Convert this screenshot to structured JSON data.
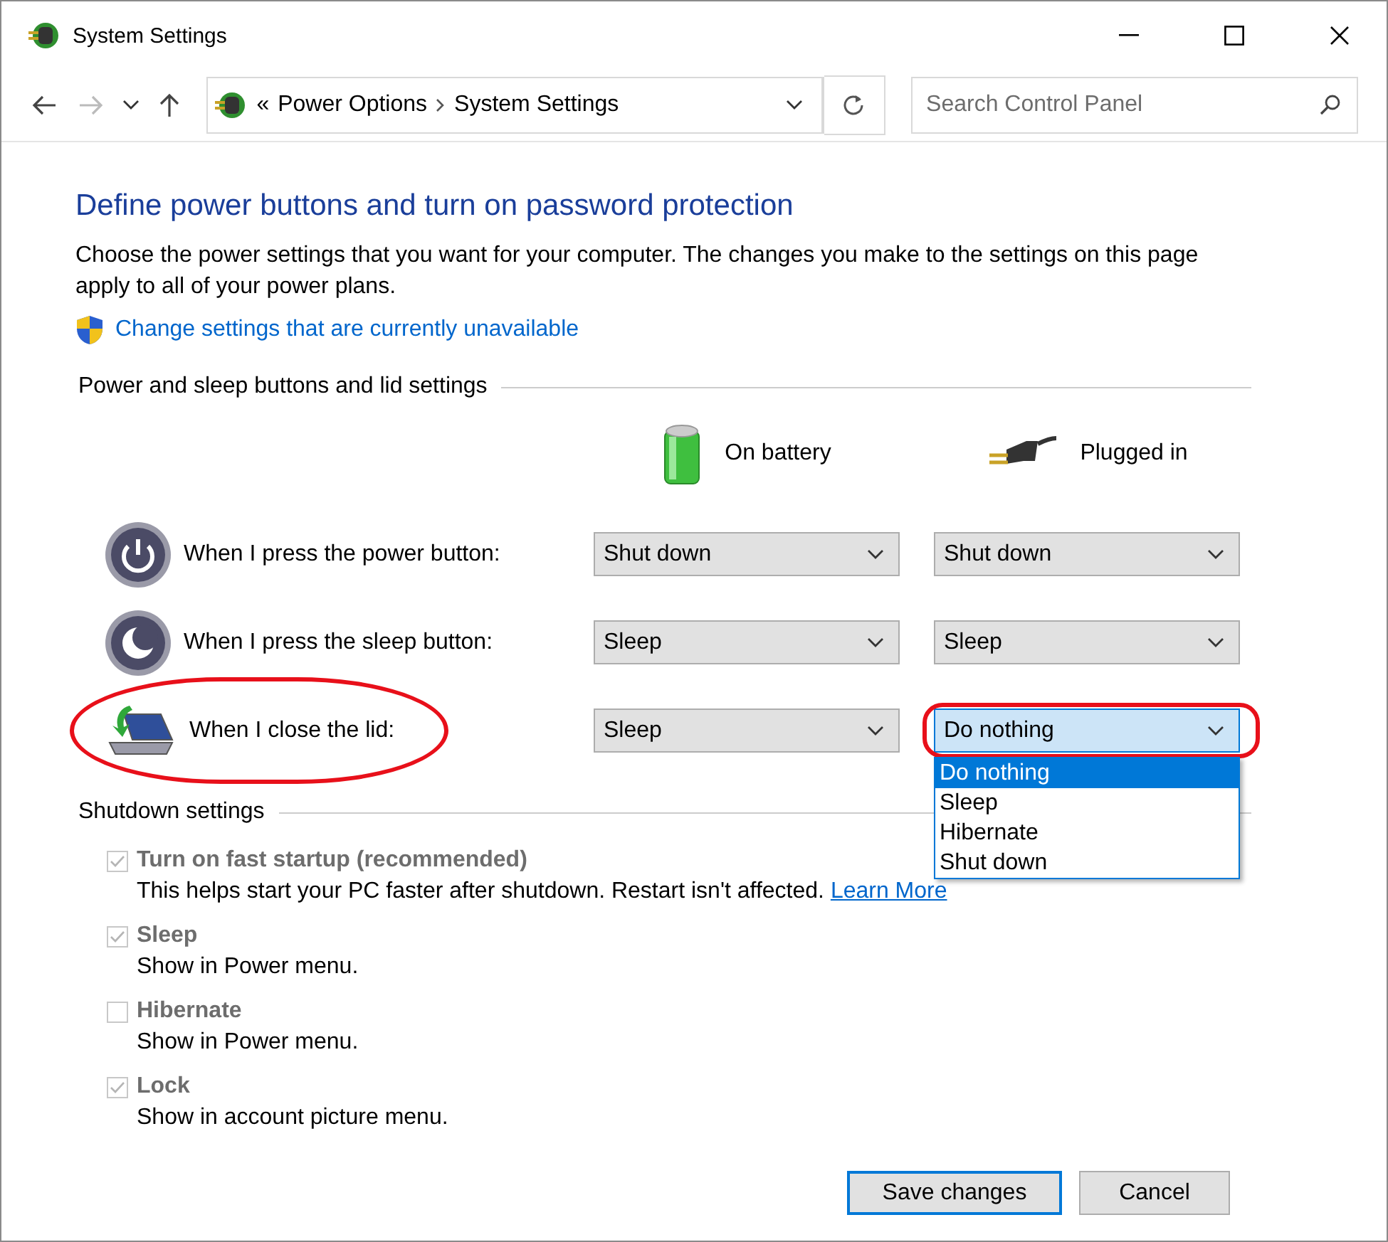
{
  "window": {
    "title": "System Settings"
  },
  "address_bar": {
    "overflow": "«",
    "crumbs": [
      "Power Options",
      "System Settings"
    ]
  },
  "search": {
    "placeholder": "Search Control Panel"
  },
  "heading": "Define power buttons and turn on password protection",
  "description": "Choose the power settings that you want for your computer. The changes you make to the settings on this page apply to all of your power plans.",
  "admin_link": "Change settings that are currently unavailable",
  "buttons_section": {
    "title": "Power and sleep buttons and lid settings",
    "columns": [
      {
        "kind": "battery",
        "label": "On battery"
      },
      {
        "kind": "plug",
        "label": "Plugged in"
      }
    ],
    "rows": [
      {
        "kind": "power",
        "label": "When I press the power button:",
        "on_battery": {
          "value": "Shut down"
        },
        "plugged_in": {
          "value": "Shut down"
        }
      },
      {
        "kind": "sleep",
        "label": "When I press the sleep button:",
        "on_battery": {
          "value": "Sleep"
        },
        "plugged_in": {
          "value": "Sleep"
        }
      },
      {
        "kind": "lid",
        "label": "When I close the lid:",
        "highlighted": true,
        "on_battery": {
          "value": "Sleep"
        },
        "plugged_in": {
          "value": "Do nothing",
          "highlighted": true,
          "options": [
            {
              "label": "Do nothing",
              "selected": true
            },
            {
              "label": "Sleep",
              "selected": false
            },
            {
              "label": "Hibernate",
              "selected": false
            },
            {
              "label": "Shut down",
              "selected": false
            }
          ]
        }
      }
    ]
  },
  "shutdown_section": {
    "title": "Shutdown settings",
    "options": [
      {
        "label": "Turn on fast startup (recommended)",
        "checked": true,
        "disabled": true,
        "description": "This helps start your PC faster after shutdown. Restart isn't affected.",
        "link": "Learn More"
      },
      {
        "label": "Sleep",
        "checked": true,
        "disabled": true,
        "description": "Show in Power menu."
      },
      {
        "label": "Hibernate",
        "checked": false,
        "disabled": true,
        "description": "Show in Power menu."
      },
      {
        "label": "Lock",
        "checked": true,
        "disabled": true,
        "description": "Show in account picture menu."
      }
    ]
  },
  "footer_buttons": [
    {
      "label": "Save changes",
      "default": true
    },
    {
      "label": "Cancel",
      "default": false
    }
  ]
}
